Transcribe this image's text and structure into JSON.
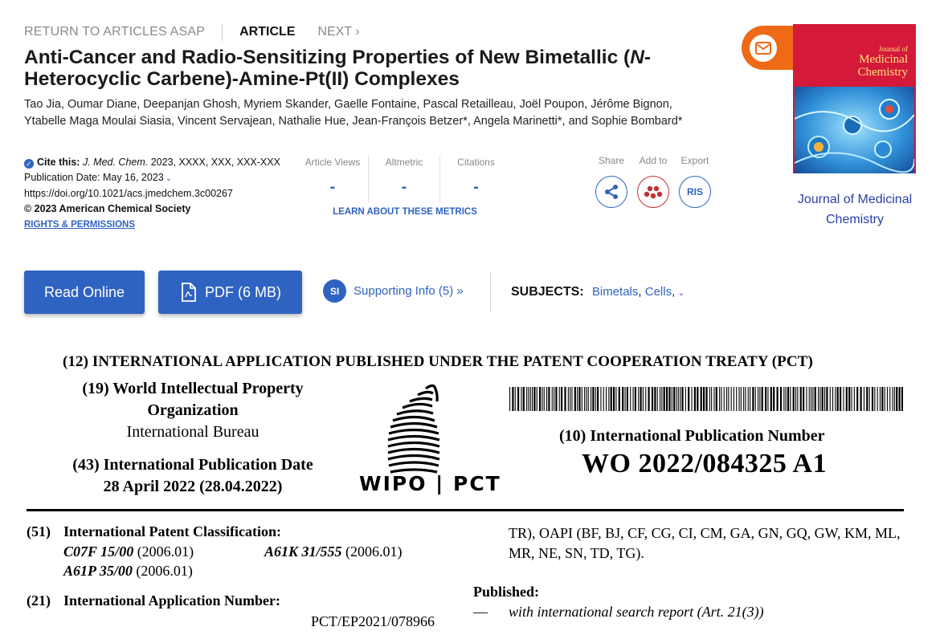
{
  "nav": {
    "return_label": "RETURN TO ARTICLES ASAP",
    "article_label": "ARTICLE",
    "next_label": "NEXT ›"
  },
  "article": {
    "title_part1": "Anti-Cancer and Radio-Sensitizing Properties of New Bimetallic (",
    "title_italic": "N",
    "title_part2": "-Heterocyclic Carbene)-Amine-Pt(II) Complexes",
    "authors": "Tao Jia, Oumar Diane, Deepanjan Ghosh, Myriem Skander, Gaelle Fontaine, Pascal Retailleau, Joël Poupon, Jérôme Bignon, Ytabelle Maga Moulai Siasia, Vincent Servajean, Nathalie Hue, Jean-François Betzer*, Angela Marinetti*, and Sophie Bombard*"
  },
  "citation": {
    "cite_label": "Cite this:",
    "journal": "J. Med. Chem.",
    "ref": "2023, XXXX, XXX, XXX-XXX",
    "pub_date": "Publication Date: May 16, 2023",
    "doi": "https://doi.org/10.1021/acs.jmedchem.3c00267",
    "copyright": "© 2023 American Chemical Society",
    "rights": "RIGHTS & PERMISSIONS"
  },
  "metrics": {
    "items": [
      {
        "label": "Article Views",
        "value": "-"
      },
      {
        "label": "Altmetric",
        "value": "-"
      },
      {
        "label": "Citations",
        "value": "-"
      }
    ],
    "learn_more": "LEARN ABOUT THESE METRICS"
  },
  "actions": {
    "share_label": "Share",
    "add_label": "Add to",
    "export_label": "Export",
    "ris": "RIS"
  },
  "journal": {
    "cover_small": "Journal of",
    "cover_line1": "Medicinal",
    "cover_line2": "Chemistry",
    "link": "Journal of Medicinal Chemistry"
  },
  "buttons": {
    "read_online": "Read Online",
    "pdf": "PDF (6 MB)",
    "si_badge": "SI",
    "supporting_info": "Supporting Info (5) »"
  },
  "subjects": {
    "heading": "SUBJECTS:",
    "items": [
      "Bimetals",
      "Cells"
    ]
  },
  "patent": {
    "header": "(12) INTERNATIONAL APPLICATION PUBLISHED UNDER THE PATENT COOPERATION TREATY (PCT)",
    "org_code": "(19) World Intellectual Property",
    "org_line2": "Organization",
    "org_line3": "International Bureau",
    "date_label": "(43) International Publication Date",
    "date_value": "28 April 2022 (28.04.2022)",
    "logo_text": "WIPO | PCT",
    "pubnum_label": "(10) International Publication Number",
    "pubnum": "WO 2022/084325 A1",
    "cls_code": "(51)",
    "cls_label": "International Patent Classification:",
    "cls1_code": "C07F 15/00",
    "cls1_year": " (2006.01)",
    "cls2_code": "A61K 31/555",
    "cls2_year": " (2006.01)",
    "cls3_code": "A61P 35/00",
    "cls3_year": " (2006.01)",
    "app_code": "(21)",
    "app_label": "International Application Number:",
    "app_number": "PCT/EP2021/078966",
    "states": "TR), OAPI (BF, BJ, CF, CG, CI, CM, GA, GN, GQ, GW, KM, ML, MR, NE, SN, TD, TG).",
    "published_label": "Published:",
    "dash": "—",
    "search_report": "with international search report (Art. 21(3))"
  }
}
